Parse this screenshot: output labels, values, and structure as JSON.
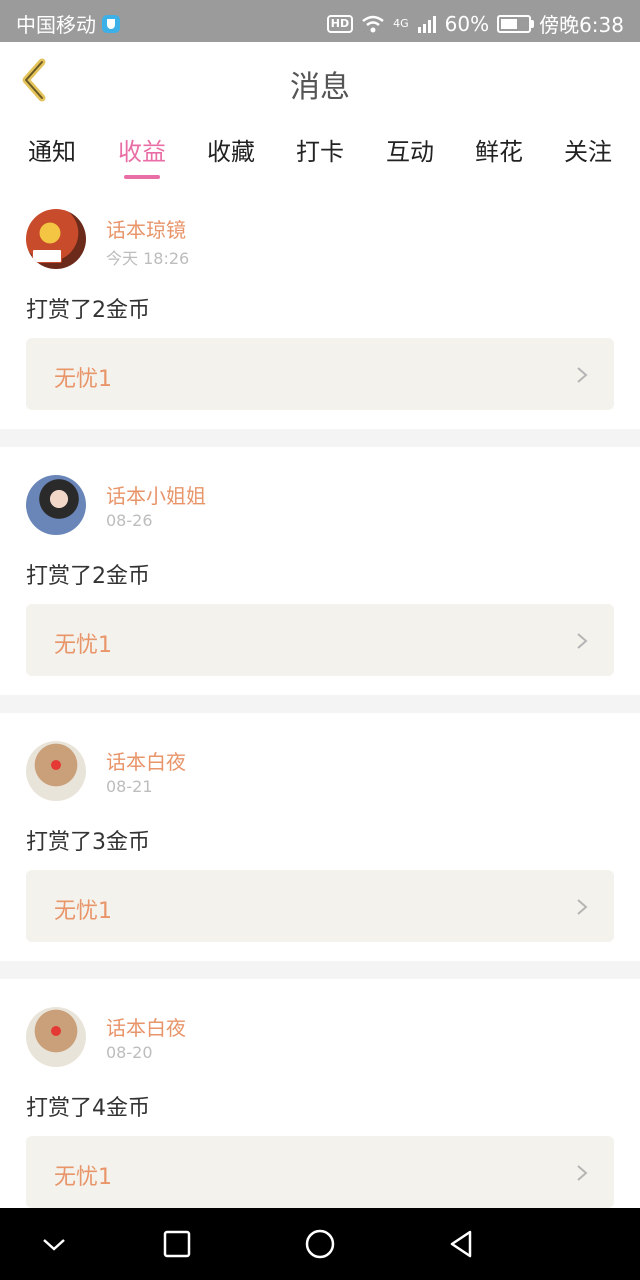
{
  "status_bar": {
    "carrier": "中国移动",
    "hd": "HD",
    "network": "4G",
    "battery": "60%",
    "time": "傍晚6:38"
  },
  "header": {
    "title": "消息"
  },
  "tabs": [
    {
      "label": "通知",
      "active": false
    },
    {
      "label": "收益",
      "active": true
    },
    {
      "label": "收藏",
      "active": false
    },
    {
      "label": "打卡",
      "active": false
    },
    {
      "label": "互动",
      "active": false
    },
    {
      "label": "鲜花",
      "active": false
    },
    {
      "label": "关注",
      "active": false
    }
  ],
  "feed": [
    {
      "user": "话本琼镜",
      "time": "今天 18:26",
      "action": "打赏了2金币",
      "target": "无忧1"
    },
    {
      "user": "话本小姐姐",
      "time": "08-26",
      "action": "打赏了2金币",
      "target": "无忧1"
    },
    {
      "user": "话本白夜",
      "time": "08-21",
      "action": "打赏了3金币",
      "target": "无忧1"
    },
    {
      "user": "话本白夜",
      "time": "08-20",
      "action": "打赏了4金币",
      "target": "无忧1"
    }
  ],
  "colors": {
    "accent": "#e86ea5",
    "username": "#e8956a",
    "card_bg": "#f4f2ec"
  }
}
